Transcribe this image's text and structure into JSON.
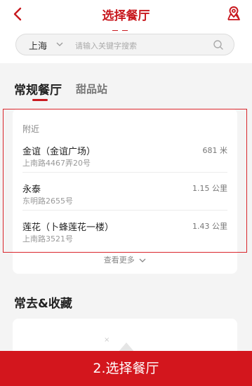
{
  "header": {
    "title": "选择餐厅"
  },
  "search": {
    "city": "上海",
    "placeholder": "请输入关键字搜索"
  },
  "tabs": [
    {
      "label": "常规餐厅"
    },
    {
      "label": "甜品站"
    }
  ],
  "nearby": {
    "section_label": "附近",
    "shops": [
      {
        "name": "金谊（金谊广场）",
        "address": "上南路4467弄20号",
        "distance": "681 米"
      },
      {
        "name": "永泰",
        "address": "东明路2655号",
        "distance": "1.15 公里"
      },
      {
        "name": "莲花（卜蜂莲花一楼）",
        "address": "上南路3521号",
        "distance": "1.43 公里"
      }
    ],
    "see_more": "查看更多"
  },
  "favorites": {
    "title": "常去&收藏",
    "empty_mark": "×"
  },
  "bottom_button": {
    "label": "2.选择餐厅"
  },
  "colors": {
    "accent": "#c8191f",
    "button": "#d3161d",
    "background": "#f4f4f4"
  },
  "icons": [
    "back-arrow-icon",
    "map-pin-icon",
    "chevron-down-icon",
    "search-icon"
  ]
}
